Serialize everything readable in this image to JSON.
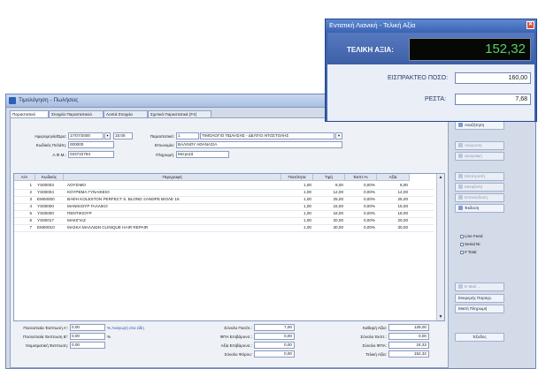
{
  "window": {
    "title": "Τιμολόγηση - Πωλήσεις"
  },
  "tabs": [
    {
      "label": "Παραστατικό"
    },
    {
      "label": "Στοιχεία Παραστατικού"
    },
    {
      "label": "Λοιπά Στοιχεία"
    },
    {
      "label": "Σχετικά Παραστατικά (F4)"
    }
  ],
  "form": {
    "date_label": "Ημερομηνία/Ώρα:",
    "date": "17/07/2000",
    "time": "15:05",
    "doc_label": "Παραστατικό:",
    "doc_num": "1",
    "doc_type": "ΤΙΜΟΛΟΓΙΟ ΠΩΛΗΣΗΣ - ΔΕΛΤΙΟ ΑΠΟΣΤΟΛΗΣ",
    "customer_code_label": "Κωδικός Πελάτη:",
    "customer_code": "000000",
    "name_label": "Επωνυμία:",
    "name": "ΒΑΛΙΝΟΥ ΑΘΑΝΑΣΙΑ",
    "afm_label": "Α.Φ.Μ.:",
    "afm": "033722784",
    "payment_label": "Πληρωμή:",
    "payment": "Μετρητά"
  },
  "grid": {
    "columns": [
      "Α/Α",
      "Κωδικός",
      "Περιγραφή",
      "Ποσότητα",
      "Τιμή",
      "Έκπτ.%",
      "Αξία"
    ],
    "rows": [
      [
        "1",
        "YS00003",
        "ΛΟΥΣΙΜΟ",
        "1,00",
        "8,00",
        "0,00%",
        "8,00"
      ],
      [
        "2",
        "YS00004",
        "ΚΟΥΡΕΜΑ ΓΥΝΑΙΚΕΙΟ",
        "1,00",
        "12,00",
        "0,00%",
        "12,00"
      ],
      [
        "3",
        "EM00000",
        "ΒΑΦΗ KOLESTON PERFECT S. BLOND ΞΑΝΘΡΕ ΒΙΟΛΕ 16",
        "1,00",
        "25,00",
        "0,00%",
        "25,00"
      ],
      [
        "4",
        "YS00000",
        "ΜΑΝΙΚΙΟΥΡ ΓΑΛΛΙΚΟ",
        "1,00",
        "15,00",
        "0,00%",
        "15,00"
      ],
      [
        "5",
        "YS00000",
        "ΠΕΝΤΙΚΙΟΥΡ",
        "1,00",
        "18,00",
        "0,00%",
        "18,00"
      ],
      [
        "6",
        "YS00017",
        "ΜΑΚΙΓΙΑΖ",
        "1,00",
        "20,00",
        "0,00%",
        "20,00"
      ],
      [
        "7",
        "EM00010",
        "ΜΑΣΚΑ ΜΑΛΛΙΩΝ CLINIQUE HAIR REPAIR",
        "1,00",
        "30,00",
        "0,00%",
        "30,00"
      ]
    ]
  },
  "buttons": {
    "new": "Αναζήτηση",
    "cancel": "Ακύρωση",
    "delete": "Διαγραφή",
    "transform": "Μετατροπή",
    "transfer": "Μεταβολή",
    "reissue": "Επανέκδοση",
    "issue": "Έκδοση",
    "line_feed": "Line Feed",
    "serial": "Serial Nr",
    "total": "# Total",
    "email": "E-Mail ...",
    "customer_card": "Εκκρεμής Παραγγ.",
    "partial_payment": "Μικτή Πληρωμή",
    "exit": "Έξοδος"
  },
  "footer": {
    "disc_a_label": "Ποσοστιαία Έκπτωση Α':",
    "disc_a": "0,00",
    "disc_a_link": "% Αναγωγή στα είδη",
    "disc_b_label": "Ποσοστιαία Έκπτωση Β':",
    "disc_b": "0,00",
    "disc_n_label": "Νομισματική Έκπτωση:",
    "disc_n": "0,00",
    "qty_label": "Σύνολο Ποσότ.:",
    "qty": "7,00",
    "vat_charge_label": "ΦΠΑ Επιβάρυνσ.:",
    "vat_charge": "0,00",
    "val_charge_label": "Αξία Επιβάρυνσ.:",
    "val_charge": "0,00",
    "tax_label": "Σύνολο Φόρου:",
    "tax": "0,00",
    "net_label": "Καθαρή Αξία:",
    "net": "128,00",
    "discount_label": "Σύνολο Έκπτ.:",
    "discount": "0,00",
    "vat_label": "Σύνολο ΦΠΑ:",
    "vat": "24,32",
    "total_label": "Τελική Αξία:",
    "total": "152,32"
  },
  "popup": {
    "title": "Εντατική Λιανική - Τελική Αξία",
    "total_label": "ΤΕΛΙΚΗ ΑΞΙΑ:",
    "total": "152,32",
    "received_label": "ΕΙΣΠΡΑΚΤΕΟ ΠΟΣΟ:",
    "received": "160,00",
    "change_label": "ΡΕΣΤΑ:",
    "change": "7,68"
  }
}
